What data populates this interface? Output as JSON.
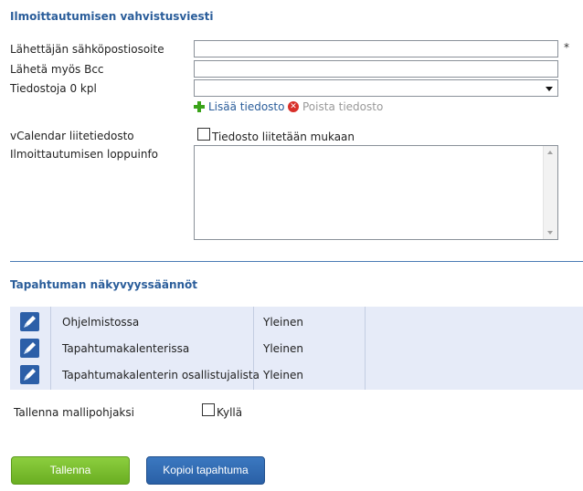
{
  "confirmation": {
    "title": "Ilmoittautumisen vahvistusviesti",
    "sender_email_label": "Lähettäjän sähköpostiosoite",
    "sender_email_value": "",
    "required_marker": "*",
    "bcc_label": "Lähetä myös Bcc",
    "bcc_value": "",
    "files_label": "Tiedostoja 0 kpl",
    "files_selected": "",
    "add_file_label": "Lisää tiedosto",
    "remove_file_label": "Poista tiedosto",
    "vcalendar_label": "vCalendar liitetiedosto",
    "vcalendar_checkbox_label": "Tiedosto liitetään mukaan",
    "end_info_label": "Ilmoittautumisen loppuinfo",
    "end_info_value": ""
  },
  "visibility": {
    "title": "Tapahtuman näkyvyyssäännöt",
    "rows": [
      {
        "name": "Ohjelmistossa",
        "value": "Yleinen"
      },
      {
        "name": "Tapahtumakalenterissa",
        "value": "Yleinen"
      },
      {
        "name": "Tapahtumakalenterin osallistujalista",
        "value": "Yleinen"
      }
    ]
  },
  "template": {
    "label": "Tallenna mallipohjaksi",
    "checkbox_label": "Kyllä"
  },
  "actions": {
    "save_label": "Tallenna",
    "copy_label": "Kopioi tapahtuma"
  },
  "colors": {
    "section_title": "#2a5d9a",
    "table_bg": "#e6ebf8",
    "save_button": "#78bd2f",
    "copy_button": "#2f67ad"
  },
  "icons": {
    "add_file": "plus-icon",
    "remove_file": "remove-icon",
    "edit_rule": "pencil-edit-icon"
  }
}
